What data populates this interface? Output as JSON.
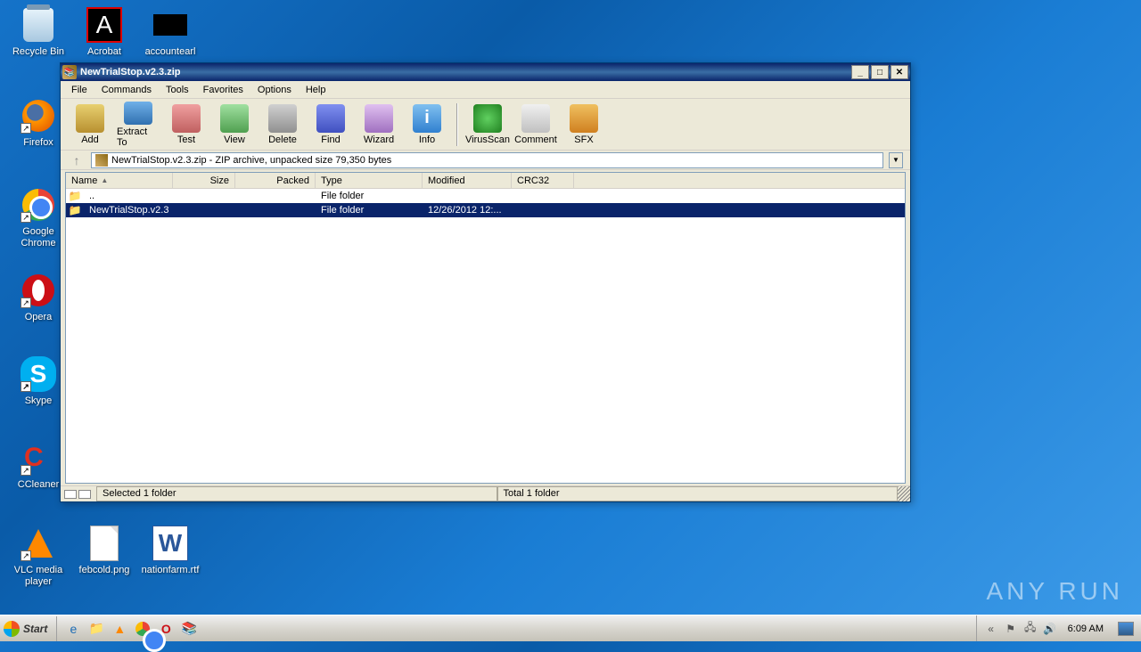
{
  "desktop_icons": {
    "recycle_bin": "Recycle Bin",
    "acrobat": "Acrobat",
    "accountearl": "accountearl",
    "firefox": "Firefox",
    "chrome": "Google Chrome",
    "opera": "Opera",
    "skype": "Skype",
    "ccleaner": "CCleaner",
    "vlc": "VLC media player",
    "febcold": "febcold.png",
    "nationfarm": "nationfarm.rtf"
  },
  "window": {
    "title": "NewTrialStop.v2.3.zip"
  },
  "menu": {
    "file": "File",
    "commands": "Commands",
    "tools": "Tools",
    "favorites": "Favorites",
    "options": "Options",
    "help": "Help"
  },
  "toolbar": {
    "add": "Add",
    "extract": "Extract To",
    "test": "Test",
    "view": "View",
    "delete": "Delete",
    "find": "Find",
    "wizard": "Wizard",
    "info": "Info",
    "virus": "VirusScan",
    "comment": "Comment",
    "sfx": "SFX"
  },
  "path": "NewTrialStop.v2.3.zip - ZIP archive, unpacked size 79,350 bytes",
  "columns": {
    "name": "Name",
    "size": "Size",
    "packed": "Packed",
    "type": "Type",
    "modified": "Modified",
    "crc": "CRC32"
  },
  "rows": [
    {
      "name": "..",
      "type": "File folder",
      "modified": "",
      "selected": false
    },
    {
      "name": "NewTrialStop.v2.3",
      "type": "File folder",
      "modified": "12/26/2012 12:...",
      "selected": true
    }
  ],
  "status": {
    "left": "Selected 1 folder",
    "right": "Total 1 folder"
  },
  "taskbar": {
    "start": "Start",
    "time": "6:09 AM"
  },
  "watermark": "ANY    RUN"
}
